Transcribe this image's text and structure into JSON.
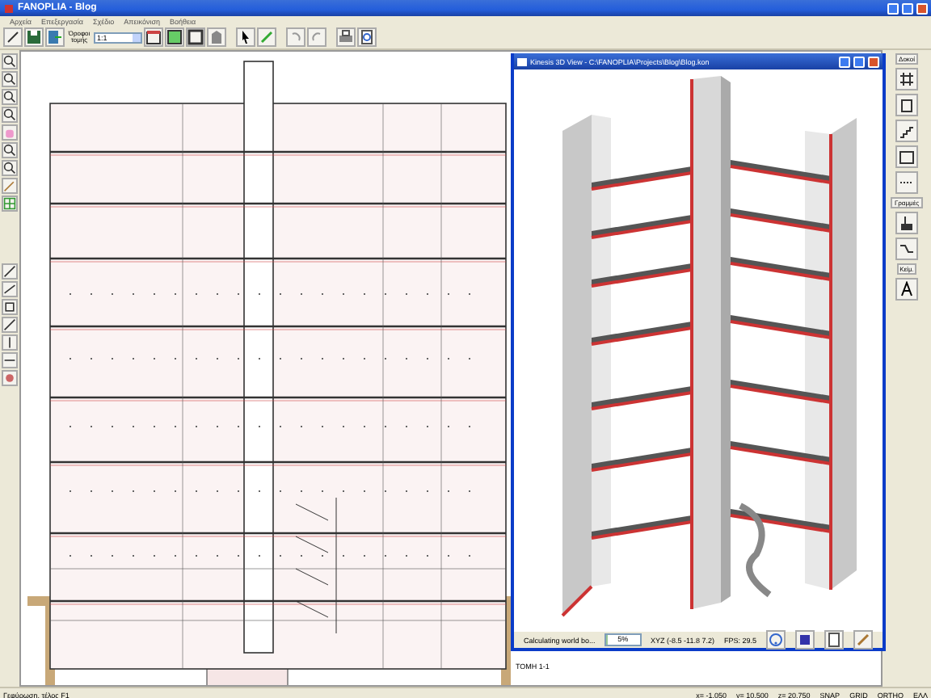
{
  "window": {
    "title": "FANOPLIA - Blog"
  },
  "menu": [
    "Αρχεία",
    "Επεξεργασία",
    "Σχέδιο",
    "Απεικόνιση",
    "Βοήθεια"
  ],
  "toolbar": {
    "floor_label": "Όροφοι τομής",
    "floor_value": "1:1"
  },
  "drawing": {
    "label": "TOMH 1-1"
  },
  "view3d": {
    "title": "Kinesis 3D View - C:\\FANOPLIA\\Projects\\Blog\\Blog.kon",
    "status": "Calculating world bo...",
    "progress": "5%",
    "level": 0.05,
    "xyz": "XYZ (-8.5 -11.8 7.2)",
    "fps": "FPS: 29.5"
  },
  "right_toolbar": [
    {
      "label": "Δοκοί"
    },
    {
      "label": "Γραμμές"
    },
    {
      "label": "Κείμ."
    }
  ],
  "status_bar": {
    "message": "Γεφύρωση, τέλος F1",
    "x": "x= -1.050",
    "y": "y= 10.500",
    "z": "z= 20.750",
    "flags": [
      "SNAP",
      "GRID",
      "ORTHO"
    ],
    "lang": "ΕΛΛ"
  }
}
